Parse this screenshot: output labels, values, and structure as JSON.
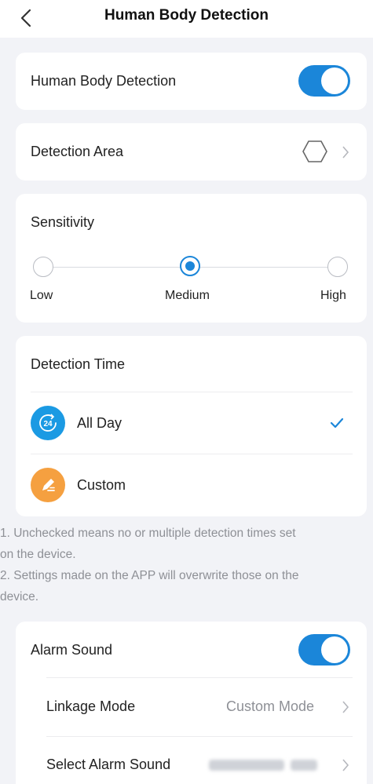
{
  "header": {
    "title": "Human Body Detection",
    "back_icon": "chevron-left-icon"
  },
  "human_detection": {
    "label": "Human Body Detection",
    "enabled": true
  },
  "detection_area": {
    "label": "Detection Area",
    "icon": "hexagon-icon"
  },
  "sensitivity": {
    "title": "Sensitivity",
    "options": [
      "Low",
      "Medium",
      "High"
    ],
    "selected": "Medium"
  },
  "detection_time": {
    "title": "Detection Time",
    "options": [
      {
        "label": "All Day",
        "icon": "24h-icon",
        "checked": true
      },
      {
        "label": "Custom",
        "icon": "pencil-icon",
        "checked": false
      }
    ]
  },
  "notes": {
    "line1": "1. Unchecked means no or multiple detection times set",
    "line2": "on the device.",
    "line3": "2. Settings made on the APP will overwrite those on the",
    "line4": "device."
  },
  "alarm": {
    "sound_label": "Alarm Sound",
    "sound_enabled": true,
    "linkage_label": "Linkage Mode",
    "linkage_value": "Custom Mode",
    "select_label": "Select Alarm Sound"
  },
  "colors": {
    "accent": "#1b86d9",
    "orange": "#f5a040",
    "background": "#f2f3f7"
  }
}
